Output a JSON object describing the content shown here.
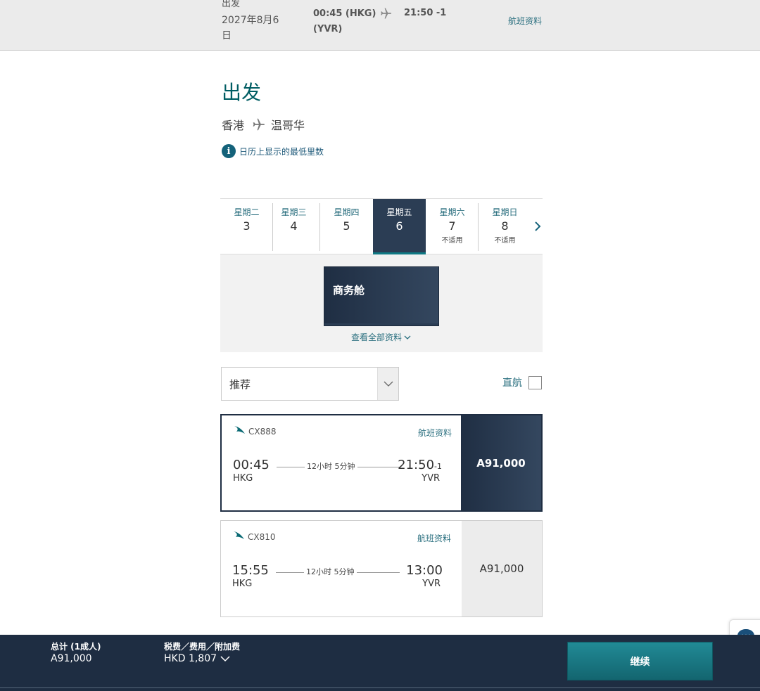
{
  "summary": {
    "label": "出发",
    "date": "2027年8月6日",
    "dep": "00:45 (HKG) (YVR)",
    "arr": "21:50 -1",
    "info": "航班资料"
  },
  "heading": {
    "title": "出发",
    "origin": "香港",
    "destination": "温哥华",
    "note": "日历上显示的最低里数"
  },
  "days": [
    {
      "weekday": "星期二",
      "date": "3",
      "note": ""
    },
    {
      "weekday": "星期三",
      "date": "4",
      "note": ""
    },
    {
      "weekday": "星期四",
      "date": "5",
      "note": ""
    },
    {
      "weekday": "星期五",
      "date": "6",
      "note": ""
    },
    {
      "weekday": "星期六",
      "date": "7",
      "note": "不适用"
    },
    {
      "weekday": "星期日",
      "date": "8",
      "note": "不适用"
    }
  ],
  "cabin": {
    "name": "商务舱",
    "view_all": "查看全部资料"
  },
  "filters": {
    "sort_value": "推荐",
    "direct_label": "直航"
  },
  "flights": [
    {
      "code": "CX888",
      "info": "航班资料",
      "dep_time": "00:45",
      "dep_code": "HKG",
      "duration": "12小时 5分钟",
      "arr_time": "21:50",
      "arr_offset": "-1",
      "arr_code": "YVR",
      "price": "A91,000"
    },
    {
      "code": "CX810",
      "info": "航班资料",
      "dep_time": "15:55",
      "dep_code": "HKG",
      "duration": "12小时 5分钟",
      "arr_time": "13:00",
      "arr_offset": "",
      "arr_code": "YVR",
      "price": "A91,000"
    }
  ],
  "footer": {
    "total_label": "总计 (1成人)",
    "total_value": "A91,000",
    "tax_label": "税费／费用／附加费",
    "tax_value": "HKD 1,807",
    "continue": "继续"
  },
  "colors": {
    "accent": "#005d63",
    "navy": "#1e2d42",
    "link": "#2a6f7f"
  }
}
